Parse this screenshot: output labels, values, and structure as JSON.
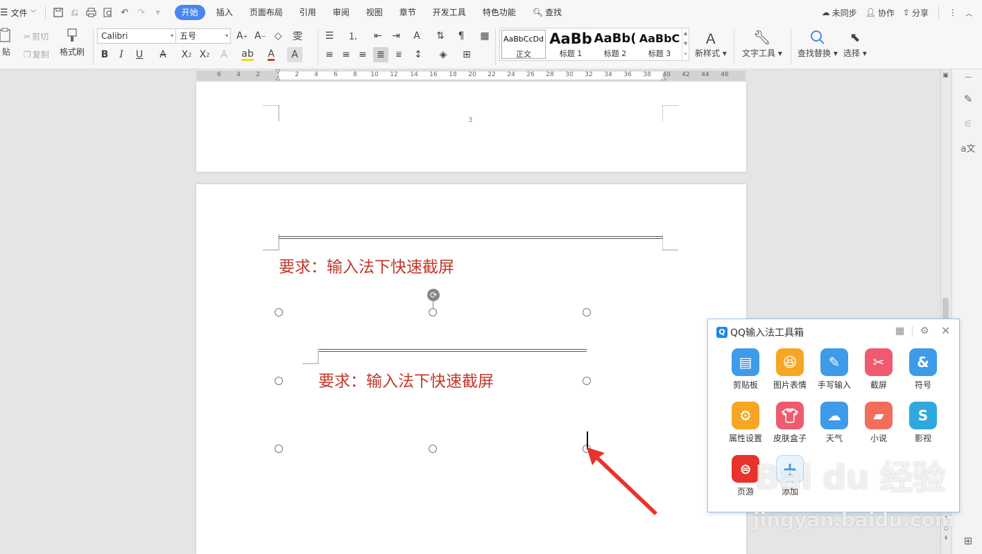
{
  "menubar": {
    "file_label": "文件",
    "tabs": [
      "开始",
      "插入",
      "页面布局",
      "引用",
      "审阅",
      "视图",
      "章节",
      "开发工具",
      "特色功能"
    ],
    "search_label": "查找",
    "sync_label": "未同步",
    "collab_label": "协作",
    "share_label": "分享"
  },
  "ribbon": {
    "paste_label": "贴",
    "cut_label": "剪切",
    "copy_label": "复制",
    "format_painter_label": "格式刷",
    "font_name": "Calibri",
    "font_size": "五号",
    "styles": [
      {
        "preview": "AaBbCcDd",
        "name": "正文"
      },
      {
        "preview": "AaBb",
        "name": "标题 1"
      },
      {
        "preview": "AaBb(",
        "name": "标题 2"
      },
      {
        "preview": "AaBbC",
        "name": "标题 3"
      }
    ],
    "new_style_label": "新样式",
    "text_tools_label": "文字工具",
    "find_replace_label": "查找替换",
    "select_label": "选择"
  },
  "ruler": {
    "ticks": [
      "6",
      "4",
      "2",
      "2",
      "4",
      "6",
      "8",
      "10",
      "12",
      "14",
      "16",
      "18",
      "20",
      "22",
      "24",
      "26",
      "28",
      "30",
      "32",
      "34",
      "36",
      "38",
      "40",
      "42",
      "44",
      "46"
    ]
  },
  "document": {
    "page_number": "3",
    "heading_text": "要求：输入法下快速截屏",
    "shape_text": "要求：输入法下快速截屏"
  },
  "qq_toolbox": {
    "title": "QQ输入法工具箱",
    "tools": [
      {
        "label": "剪贴板",
        "icon": "clipboard-icon",
        "color": "#3d9be9"
      },
      {
        "label": "图片表情",
        "icon": "emoji-icon",
        "color": "#f5a623"
      },
      {
        "label": "手写输入",
        "icon": "handwriting-icon",
        "color": "#3d9be9"
      },
      {
        "label": "截屏",
        "icon": "scissors-icon",
        "color": "#ef5a6f"
      },
      {
        "label": "符号",
        "icon": "ampersand-icon",
        "color": "#3d9be9"
      },
      {
        "label": "属性设置",
        "icon": "settings-icon",
        "color": "#f5a623"
      },
      {
        "label": "皮肤盒子",
        "icon": "skin-icon",
        "color": "#ef5a6f"
      },
      {
        "label": "天气",
        "icon": "weather-icon",
        "color": "#3d9be9"
      },
      {
        "label": "小说",
        "icon": "novel-icon",
        "color": "#f26d5b"
      },
      {
        "label": "影视",
        "icon": "video-icon",
        "color": "#2fa8e0"
      },
      {
        "label": "页游",
        "icon": "game-icon",
        "color": "#e8322c"
      },
      {
        "label": "添加",
        "icon": "add-icon",
        "color": "#e8f3fc"
      }
    ]
  },
  "watermark": {
    "logo_text": "Bai du 经验",
    "url_text": "jingyan.baidu.com"
  }
}
